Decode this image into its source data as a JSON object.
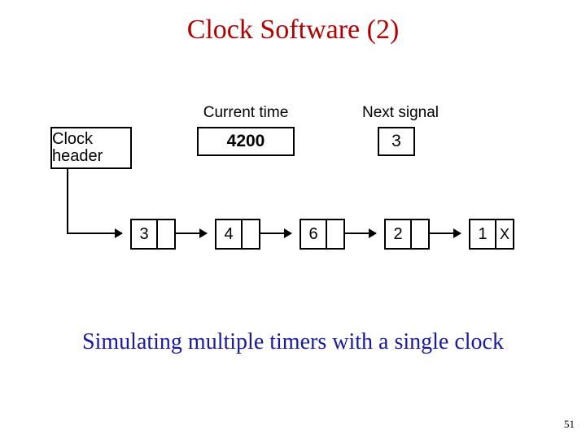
{
  "title": "Clock Software (2)",
  "caption": "Simulating multiple timers with a single clock",
  "page_number": "51",
  "labels": {
    "current_time": "Current time",
    "next_signal": "Next signal",
    "clock_header": "Clock header"
  },
  "values": {
    "current_time": "4200",
    "next_signal": "3"
  },
  "list": [
    {
      "value": "3",
      "next": ""
    },
    {
      "value": "4",
      "next": ""
    },
    {
      "value": "6",
      "next": ""
    },
    {
      "value": "2",
      "next": ""
    },
    {
      "value": "1",
      "next": "X"
    }
  ]
}
